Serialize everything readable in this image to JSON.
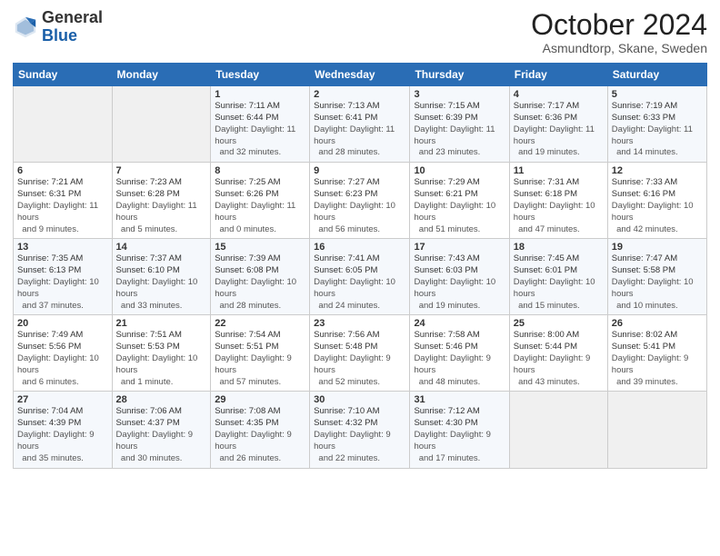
{
  "header": {
    "logo_general": "General",
    "logo_blue": "Blue",
    "month_title": "October 2024",
    "subtitle": "Asmundtorp, Skane, Sweden"
  },
  "weekdays": [
    "Sunday",
    "Monday",
    "Tuesday",
    "Wednesday",
    "Thursday",
    "Friday",
    "Saturday"
  ],
  "weeks": [
    [
      {
        "day": "",
        "sunrise": "",
        "sunset": "",
        "daylight": ""
      },
      {
        "day": "",
        "sunrise": "",
        "sunset": "",
        "daylight": ""
      },
      {
        "day": "1",
        "sunrise": "Sunrise: 7:11 AM",
        "sunset": "Sunset: 6:44 PM",
        "daylight": "Daylight: 11 hours and 32 minutes."
      },
      {
        "day": "2",
        "sunrise": "Sunrise: 7:13 AM",
        "sunset": "Sunset: 6:41 PM",
        "daylight": "Daylight: 11 hours and 28 minutes."
      },
      {
        "day": "3",
        "sunrise": "Sunrise: 7:15 AM",
        "sunset": "Sunset: 6:39 PM",
        "daylight": "Daylight: 11 hours and 23 minutes."
      },
      {
        "day": "4",
        "sunrise": "Sunrise: 7:17 AM",
        "sunset": "Sunset: 6:36 PM",
        "daylight": "Daylight: 11 hours and 19 minutes."
      },
      {
        "day": "5",
        "sunrise": "Sunrise: 7:19 AM",
        "sunset": "Sunset: 6:33 PM",
        "daylight": "Daylight: 11 hours and 14 minutes."
      }
    ],
    [
      {
        "day": "6",
        "sunrise": "Sunrise: 7:21 AM",
        "sunset": "Sunset: 6:31 PM",
        "daylight": "Daylight: 11 hours and 9 minutes."
      },
      {
        "day": "7",
        "sunrise": "Sunrise: 7:23 AM",
        "sunset": "Sunset: 6:28 PM",
        "daylight": "Daylight: 11 hours and 5 minutes."
      },
      {
        "day": "8",
        "sunrise": "Sunrise: 7:25 AM",
        "sunset": "Sunset: 6:26 PM",
        "daylight": "Daylight: 11 hours and 0 minutes."
      },
      {
        "day": "9",
        "sunrise": "Sunrise: 7:27 AM",
        "sunset": "Sunset: 6:23 PM",
        "daylight": "Daylight: 10 hours and 56 minutes."
      },
      {
        "day": "10",
        "sunrise": "Sunrise: 7:29 AM",
        "sunset": "Sunset: 6:21 PM",
        "daylight": "Daylight: 10 hours and 51 minutes."
      },
      {
        "day": "11",
        "sunrise": "Sunrise: 7:31 AM",
        "sunset": "Sunset: 6:18 PM",
        "daylight": "Daylight: 10 hours and 47 minutes."
      },
      {
        "day": "12",
        "sunrise": "Sunrise: 7:33 AM",
        "sunset": "Sunset: 6:16 PM",
        "daylight": "Daylight: 10 hours and 42 minutes."
      }
    ],
    [
      {
        "day": "13",
        "sunrise": "Sunrise: 7:35 AM",
        "sunset": "Sunset: 6:13 PM",
        "daylight": "Daylight: 10 hours and 37 minutes."
      },
      {
        "day": "14",
        "sunrise": "Sunrise: 7:37 AM",
        "sunset": "Sunset: 6:10 PM",
        "daylight": "Daylight: 10 hours and 33 minutes."
      },
      {
        "day": "15",
        "sunrise": "Sunrise: 7:39 AM",
        "sunset": "Sunset: 6:08 PM",
        "daylight": "Daylight: 10 hours and 28 minutes."
      },
      {
        "day": "16",
        "sunrise": "Sunrise: 7:41 AM",
        "sunset": "Sunset: 6:05 PM",
        "daylight": "Daylight: 10 hours and 24 minutes."
      },
      {
        "day": "17",
        "sunrise": "Sunrise: 7:43 AM",
        "sunset": "Sunset: 6:03 PM",
        "daylight": "Daylight: 10 hours and 19 minutes."
      },
      {
        "day": "18",
        "sunrise": "Sunrise: 7:45 AM",
        "sunset": "Sunset: 6:01 PM",
        "daylight": "Daylight: 10 hours and 15 minutes."
      },
      {
        "day": "19",
        "sunrise": "Sunrise: 7:47 AM",
        "sunset": "Sunset: 5:58 PM",
        "daylight": "Daylight: 10 hours and 10 minutes."
      }
    ],
    [
      {
        "day": "20",
        "sunrise": "Sunrise: 7:49 AM",
        "sunset": "Sunset: 5:56 PM",
        "daylight": "Daylight: 10 hours and 6 minutes."
      },
      {
        "day": "21",
        "sunrise": "Sunrise: 7:51 AM",
        "sunset": "Sunset: 5:53 PM",
        "daylight": "Daylight: 10 hours and 1 minute."
      },
      {
        "day": "22",
        "sunrise": "Sunrise: 7:54 AM",
        "sunset": "Sunset: 5:51 PM",
        "daylight": "Daylight: 9 hours and 57 minutes."
      },
      {
        "day": "23",
        "sunrise": "Sunrise: 7:56 AM",
        "sunset": "Sunset: 5:48 PM",
        "daylight": "Daylight: 9 hours and 52 minutes."
      },
      {
        "day": "24",
        "sunrise": "Sunrise: 7:58 AM",
        "sunset": "Sunset: 5:46 PM",
        "daylight": "Daylight: 9 hours and 48 minutes."
      },
      {
        "day": "25",
        "sunrise": "Sunrise: 8:00 AM",
        "sunset": "Sunset: 5:44 PM",
        "daylight": "Daylight: 9 hours and 43 minutes."
      },
      {
        "day": "26",
        "sunrise": "Sunrise: 8:02 AM",
        "sunset": "Sunset: 5:41 PM",
        "daylight": "Daylight: 9 hours and 39 minutes."
      }
    ],
    [
      {
        "day": "27",
        "sunrise": "Sunrise: 7:04 AM",
        "sunset": "Sunset: 4:39 PM",
        "daylight": "Daylight: 9 hours and 35 minutes."
      },
      {
        "day": "28",
        "sunrise": "Sunrise: 7:06 AM",
        "sunset": "Sunset: 4:37 PM",
        "daylight": "Daylight: 9 hours and 30 minutes."
      },
      {
        "day": "29",
        "sunrise": "Sunrise: 7:08 AM",
        "sunset": "Sunset: 4:35 PM",
        "daylight": "Daylight: 9 hours and 26 minutes."
      },
      {
        "day": "30",
        "sunrise": "Sunrise: 7:10 AM",
        "sunset": "Sunset: 4:32 PM",
        "daylight": "Daylight: 9 hours and 22 minutes."
      },
      {
        "day": "31",
        "sunrise": "Sunrise: 7:12 AM",
        "sunset": "Sunset: 4:30 PM",
        "daylight": "Daylight: 9 hours and 17 minutes."
      },
      {
        "day": "",
        "sunrise": "",
        "sunset": "",
        "daylight": ""
      },
      {
        "day": "",
        "sunrise": "",
        "sunset": "",
        "daylight": ""
      }
    ]
  ]
}
